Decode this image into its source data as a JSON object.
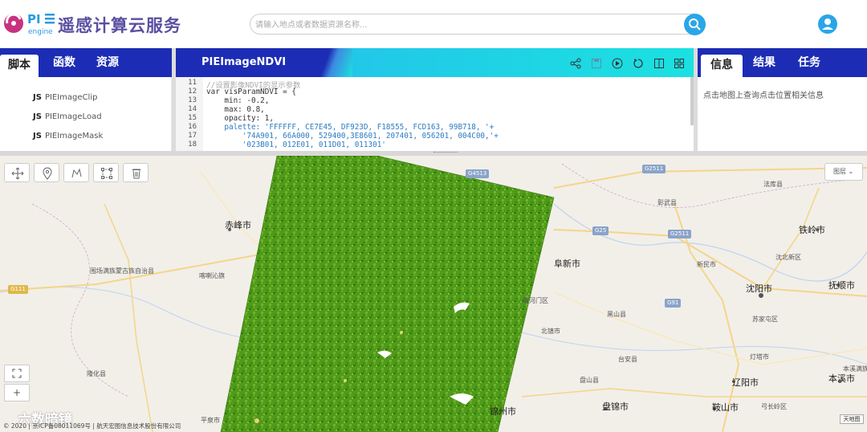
{
  "header": {
    "brand_logo_text": "PIE engine",
    "brand_name": "遥感计算云服务",
    "search_placeholder": "请输入地点或者数据资源名称...",
    "colors": {
      "primary": "#1c2cb5",
      "accent": "#2aa6e8",
      "cyan": "#1be1e1"
    }
  },
  "left_panel": {
    "tabs": [
      {
        "label": "脚本",
        "active": true
      },
      {
        "label": "函数",
        "active": false
      },
      {
        "label": "资源",
        "active": false
      }
    ],
    "items": [
      {
        "prefix": "JS",
        "name": "PIEImageClip"
      },
      {
        "prefix": "JS",
        "name": "PIEImageLoad"
      },
      {
        "prefix": "JS",
        "name": "PIEImageMask"
      }
    ]
  },
  "editor": {
    "title": "PIEImageNDVI",
    "toolbar_icons": [
      "share-icon",
      "save-icon",
      "run-icon",
      "reset-icon",
      "split-icon",
      "layout-icon"
    ],
    "lines": [
      {
        "n": "11",
        "text": "//设置影像NDVI的显示参数"
      },
      {
        "n": "12",
        "text": "var visParamNDVI = {"
      },
      {
        "n": "13",
        "text": "    min: -0.2,"
      },
      {
        "n": "14",
        "text": "    max: 0.8,"
      },
      {
        "n": "15",
        "text": "    opacity: 1,"
      },
      {
        "n": "16",
        "text": "    palette: 'FFFFFF, CE7E45, DF923D, F18555, FCD163, 99B718, '+"
      },
      {
        "n": "17",
        "text": "        '74A901, 66A000, 529400,3E8601, 207401, 056201, 004C00,'+"
      },
      {
        "n": "18",
        "text": "        '023B01, 012E01, 011D01, 011301'"
      }
    ]
  },
  "right_panel": {
    "tabs": [
      {
        "label": "信息",
        "active": true
      },
      {
        "label": "结果",
        "active": false
      },
      {
        "label": "任务",
        "active": false
      }
    ],
    "info_text": "点击地图上查询点击位置相关信息"
  },
  "map": {
    "layer_button": "图层",
    "zoom_fit_icon": "fullscreen-icon",
    "zoom_in": "+",
    "copyright": "© 2020 | 京ICP备08011069号 | 航天宏图信息技术股份有限公司",
    "watermark": "六数暗镜",
    "map_logo": "天地图",
    "labels": [
      {
        "text": "赤峰市",
        "cls": "big"
      },
      {
        "text": "围场满族蒙古族自治县",
        "cls": "small"
      },
      {
        "text": "喀喇沁旗",
        "cls": "small"
      },
      {
        "text": "隆化县",
        "cls": "small"
      },
      {
        "text": "平泉市",
        "cls": "small"
      },
      {
        "text": "法库县",
        "cls": "small"
      },
      {
        "text": "彰武县",
        "cls": "small"
      },
      {
        "text": "铁岭市",
        "cls": "big"
      },
      {
        "text": "阜新市",
        "cls": "big"
      },
      {
        "text": "沈北新区",
        "cls": "small"
      },
      {
        "text": "新民市",
        "cls": "small"
      },
      {
        "text": "沈阳市",
        "cls": "big"
      },
      {
        "text": "抚顺市",
        "cls": "big"
      },
      {
        "text": "清河门区",
        "cls": "small"
      },
      {
        "text": "黑山县",
        "cls": "small"
      },
      {
        "text": "苏家屯区",
        "cls": "small"
      },
      {
        "text": "北镇市",
        "cls": "small"
      },
      {
        "text": "台安县",
        "cls": "small"
      },
      {
        "text": "灯塔市",
        "cls": "small"
      },
      {
        "text": "辽阳市",
        "cls": "big"
      },
      {
        "text": "本溪市",
        "cls": "big"
      },
      {
        "text": "本溪满族自治县",
        "cls": "small"
      },
      {
        "text": "盘山县",
        "cls": "small"
      },
      {
        "text": "盘锦市",
        "cls": "big"
      },
      {
        "text": "鞍山市",
        "cls": "big"
      },
      {
        "text": "弓长岭区",
        "cls": "small"
      },
      {
        "text": "锦州市",
        "cls": "big"
      }
    ],
    "shields": [
      "G4513",
      "G2511",
      "G25",
      "G2511",
      "G111",
      "G91"
    ]
  }
}
